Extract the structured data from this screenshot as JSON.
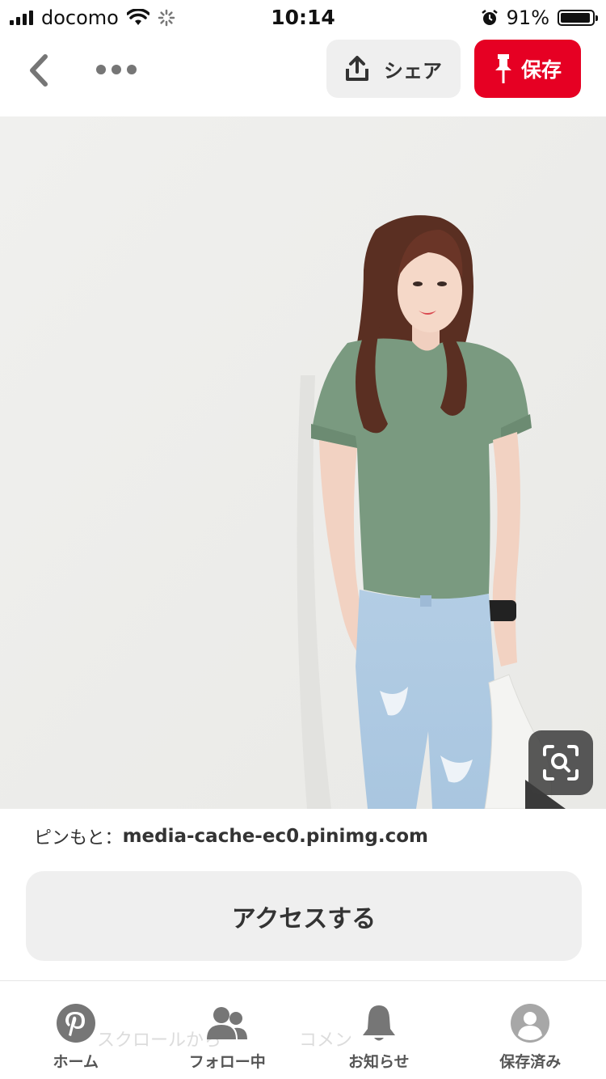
{
  "status_bar": {
    "carrier": "docomo",
    "time": "10:14",
    "battery": "91%"
  },
  "toolbar": {
    "share_label": "シェア",
    "save_label": "保存"
  },
  "colors": {
    "accent_red": "#e60023",
    "button_gray": "#efefef",
    "tshirt_green": "#7a9a80",
    "jeans_blue": "#b7d0e6"
  },
  "pin": {
    "source_prefix": "ピンもと：",
    "source_domain": "media-cache-ec0.pinimg.com",
    "access_label": "アクセスする"
  },
  "background_overlay": {
    "scroll_hint": "スクロールから",
    "comment_hint": "コメン"
  },
  "tabs": [
    {
      "label": "ホーム",
      "icon": "pinterest-logo-icon"
    },
    {
      "label": "フォロー中",
      "icon": "people-icon"
    },
    {
      "label": "お知らせ",
      "icon": "bell-icon"
    },
    {
      "label": "保存済み",
      "icon": "profile-icon"
    }
  ]
}
